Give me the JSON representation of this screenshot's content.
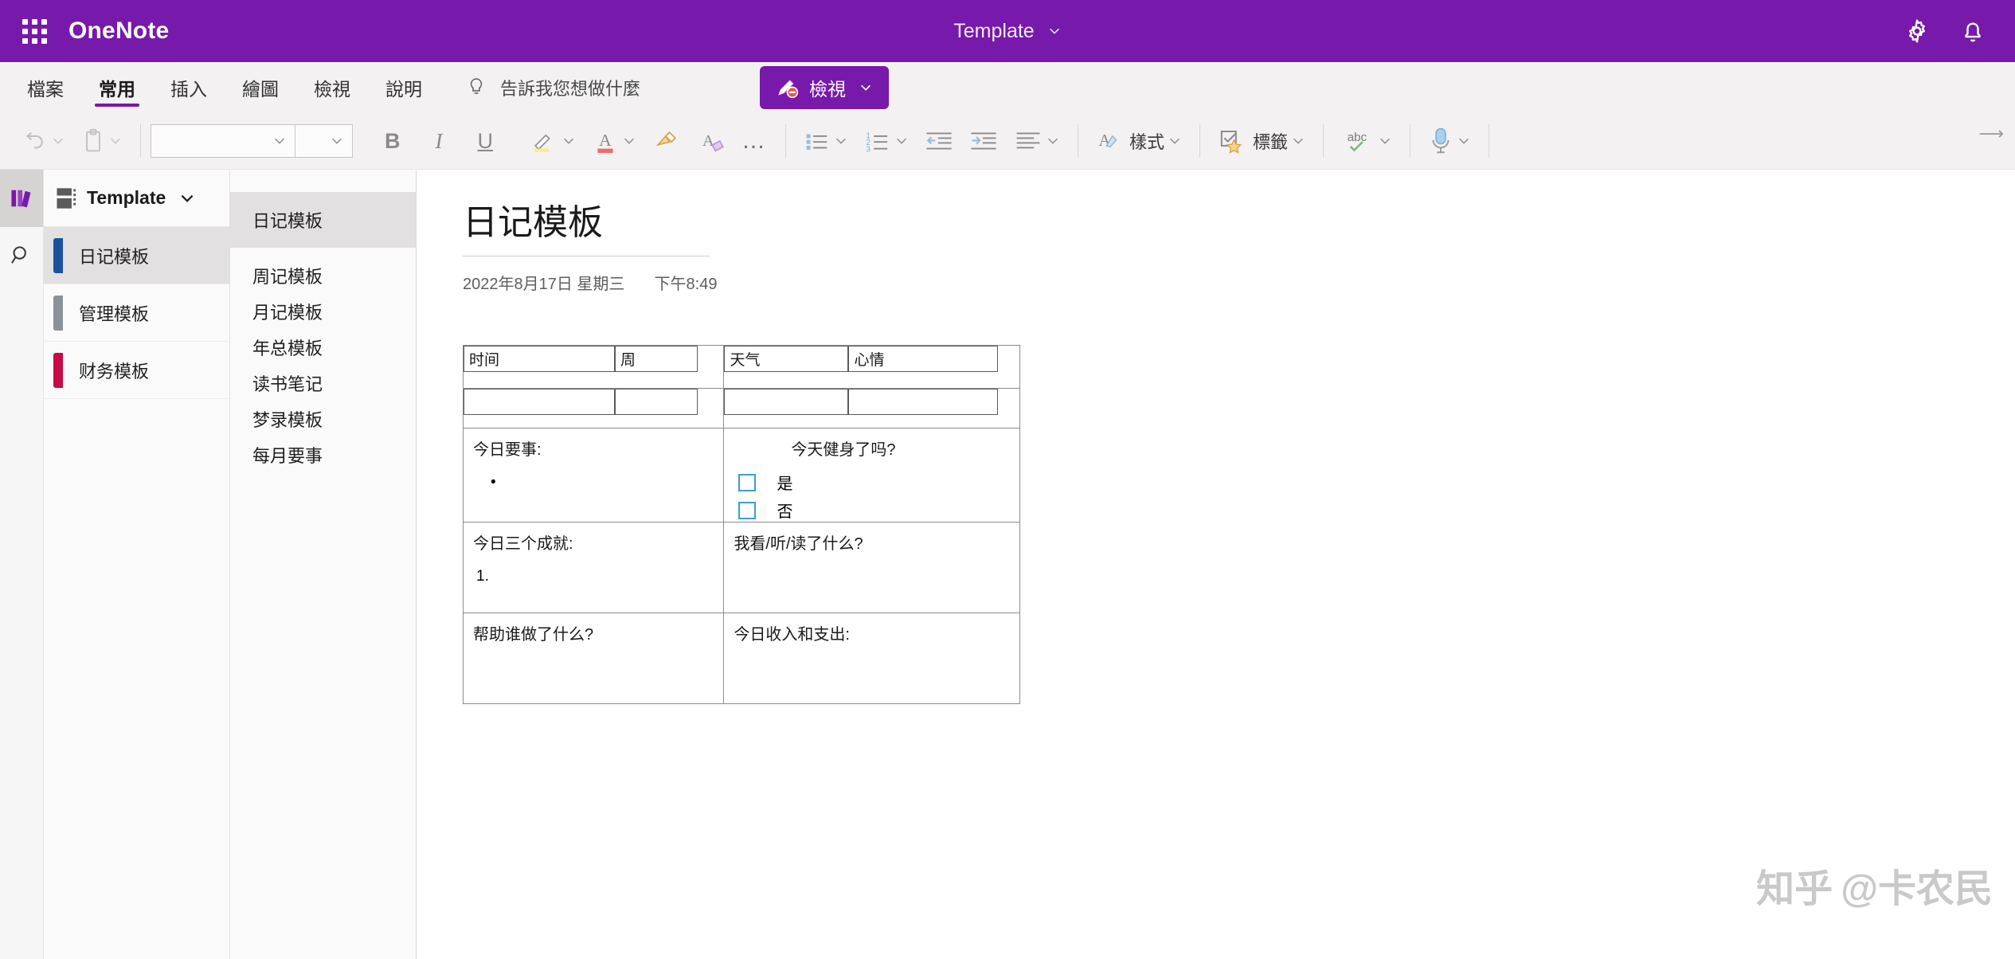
{
  "titlebar": {
    "app_name": "OneNote",
    "waffle_icon": "app-launcher-icon",
    "doc_title": "Template",
    "doc_title_chevron": "chevron-down-icon",
    "settings_icon": "gear-icon",
    "notifications_icon": "bell-icon",
    "background": "#7719aa"
  },
  "ribbon": {
    "tabs": [
      {
        "label": "檔案",
        "active": false
      },
      {
        "label": "常用",
        "active": true
      },
      {
        "label": "插入",
        "active": false
      },
      {
        "label": "繪圖",
        "active": false
      },
      {
        "label": "檢視",
        "active": false
      },
      {
        "label": "說明",
        "active": false
      }
    ],
    "tell_me": {
      "icon": "lightbulb-icon",
      "text": "告訴我您想做什麼"
    },
    "view_button": {
      "label": "檢視",
      "icon": "pen-disabled-icon",
      "chevron": "chevron-down-icon",
      "color": "#7719aa"
    },
    "accent_color": "#7719aa"
  },
  "toolbar": {
    "undo": "undo-icon",
    "paste": "paste-icon",
    "font_name": {
      "value": "",
      "placeholder": ""
    },
    "font_size": {
      "value": "",
      "placeholder": ""
    },
    "bold": "B",
    "italic": "I",
    "underline": "U",
    "highlight": "highlighter-icon",
    "font_color": "A",
    "format_painter": "format-painter-icon",
    "clear_formatting": "clear-formatting-icon",
    "more": "…",
    "bullets": "bulleted-list-icon",
    "numbering": "numbered-list-icon",
    "decrease_indent": "decrease-indent-icon",
    "increase_indent": "increase-indent-icon",
    "align": "align-icon",
    "styles_label": "樣式",
    "tags_label": "標籤",
    "spellcheck_label": "abc",
    "dictate": "microphone-icon"
  },
  "rail": {
    "notebooks_icon": "notebooks-icon",
    "search_icon": "search-icon"
  },
  "notebook": {
    "name": "Template",
    "icon": "notebook-icon",
    "chevron": "chevron-down-icon",
    "sections": [
      {
        "label": "日记模板",
        "color": "#1b52a0",
        "selected": true
      },
      {
        "label": "管理模板",
        "color": "#8b9199",
        "selected": false
      },
      {
        "label": "财务模板",
        "color": "#c80a46",
        "selected": false
      }
    ]
  },
  "pages": [
    {
      "label": "日记模板",
      "selected": true
    },
    {
      "label": "周记模板",
      "selected": false
    },
    {
      "label": "月记模板",
      "selected": false
    },
    {
      "label": "年总模板",
      "selected": false
    },
    {
      "label": "读书笔记",
      "selected": false
    },
    {
      "label": "梦录模板",
      "selected": false
    },
    {
      "label": "每月要事",
      "selected": false
    }
  ],
  "page": {
    "title": "日记模板",
    "date": "2022年8月17日 星期三",
    "time": "下午8:49"
  },
  "journal": {
    "header_left": {
      "field1": "时间",
      "field2": "周"
    },
    "header_right": {
      "field1": "天气",
      "field2": "心情"
    },
    "value_left": {
      "field1": "",
      "field2": ""
    },
    "value_right": {
      "field1": "",
      "field2": ""
    },
    "todo_title": "今日要事:",
    "todo_bullet": "•",
    "gym_title": "今天健身了吗?",
    "gym_yes": "是",
    "gym_no": "否",
    "achievements_title": "今日三个成就:",
    "achievements_item": "1.",
    "media_title": "我看/听/读了什么?",
    "help_title": "帮助谁做了什么?",
    "money_title": "今日收入和支出:"
  },
  "watermark": {
    "logo": "知乎",
    "handle": "@卡农民"
  }
}
